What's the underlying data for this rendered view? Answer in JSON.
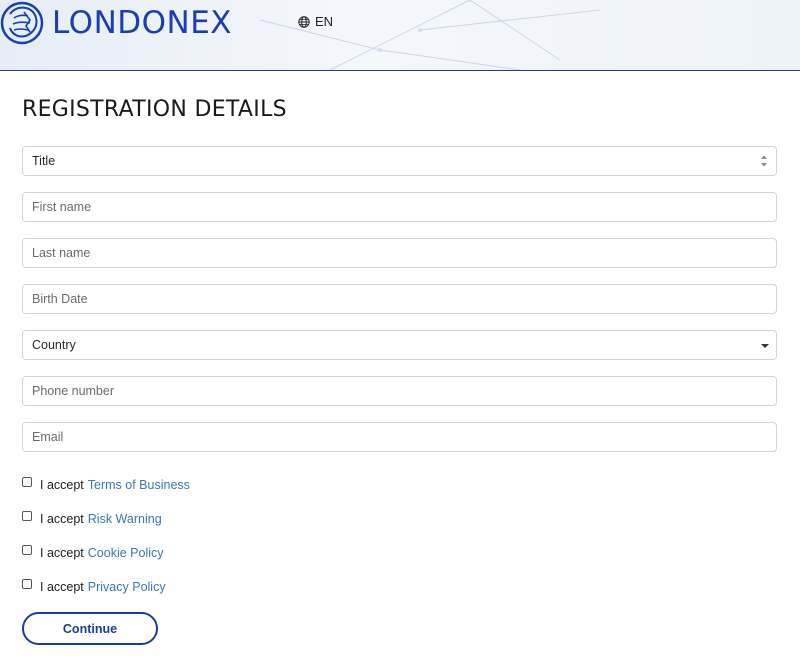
{
  "brand": {
    "name": "LONDONEX",
    "color": "#1c3fb0"
  },
  "language": {
    "icon": "globe-icon",
    "code": "EN"
  },
  "page": {
    "title": "REGISTRATION DETAILS"
  },
  "form": {
    "title_select": {
      "label": "Title"
    },
    "first_name": {
      "placeholder": "First name"
    },
    "last_name": {
      "placeholder": "Last name"
    },
    "birth_date": {
      "placeholder": "Birth Date"
    },
    "country_select": {
      "label": "Country"
    },
    "phone": {
      "placeholder": "Phone number"
    },
    "email": {
      "placeholder": "Email"
    }
  },
  "consents": [
    {
      "prefix": "I accept",
      "link": "Terms of Business"
    },
    {
      "prefix": "I accept",
      "link": "Risk Warning"
    },
    {
      "prefix": "I accept",
      "link": "Cookie Policy"
    },
    {
      "prefix": "I accept",
      "link": "Privacy Policy"
    }
  ],
  "actions": {
    "continue_label": "Continue"
  },
  "colors": {
    "accent": "#1f3a9e",
    "link": "#3a78b5",
    "border": "#cfd4da"
  }
}
